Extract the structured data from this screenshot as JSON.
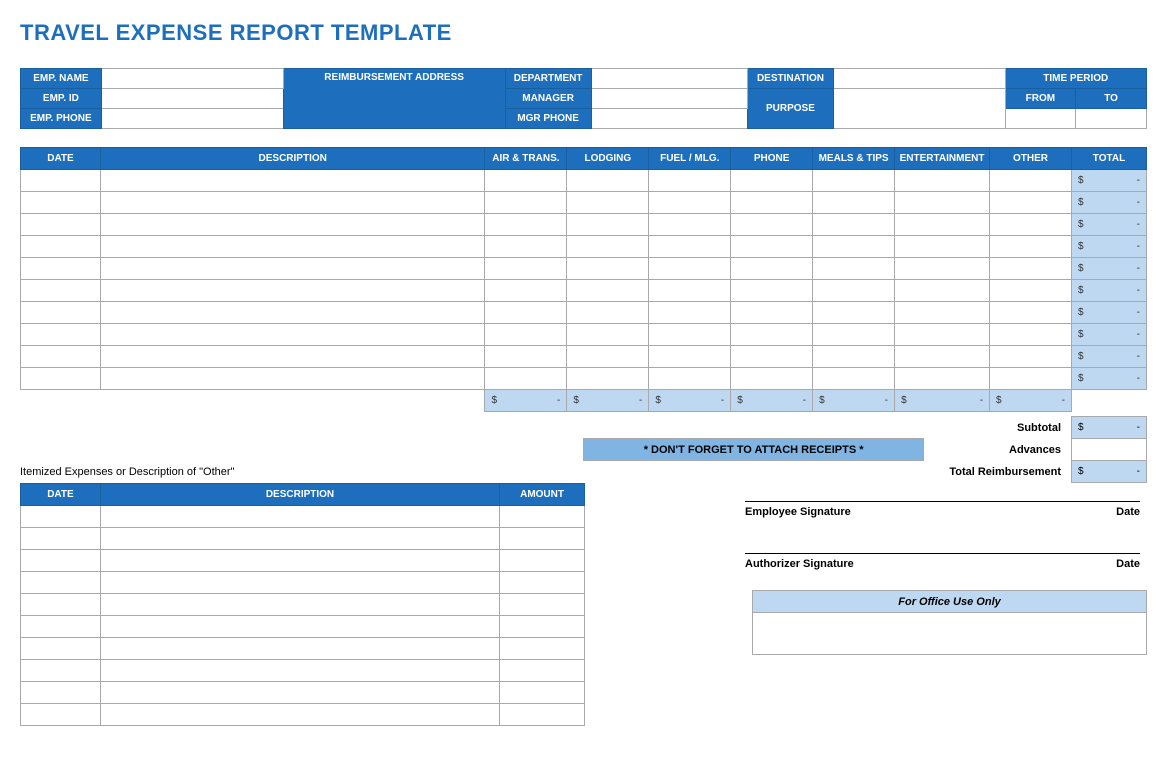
{
  "title": "TRAVEL EXPENSE REPORT TEMPLATE",
  "header": {
    "emp_name": "EMP. NAME",
    "emp_id": "EMP. ID",
    "emp_phone": "EMP. PHONE",
    "reimb_addr": "REIMBURSEMENT ADDRESS",
    "department": "DEPARTMENT",
    "manager": "MANAGER",
    "mgr_phone": "MGR PHONE",
    "destination": "DESTINATION",
    "purpose": "PURPOSE",
    "time_period": "TIME PERIOD",
    "from": "FROM",
    "to": "TO"
  },
  "grid_headers": {
    "date": "DATE",
    "description": "DESCRIPTION",
    "air": "AIR & TRANS.",
    "lodging": "LODGING",
    "fuel": "FUEL / MLG.",
    "phone": "PHONE",
    "meals": "MEALS & TIPS",
    "entertainment": "ENTERTAINMENT",
    "other": "OTHER",
    "total": "TOTAL"
  },
  "row_total": {
    "currency": "$",
    "dash": "-"
  },
  "summary": {
    "subtotal": "Subtotal",
    "advances": "Advances",
    "total_reimb": "Total Reimbursement",
    "receipts": "* DON'T FORGET TO ATTACH RECEIPTS *"
  },
  "itemized": {
    "title": "Itemized Expenses or Description of \"Other\"",
    "date": "DATE",
    "description": "DESCRIPTION",
    "amount": "AMOUNT"
  },
  "signatures": {
    "employee": "Employee Signature",
    "authorizer": "Authorizer Signature",
    "date": "Date"
  },
  "office": "For Office Use Only"
}
